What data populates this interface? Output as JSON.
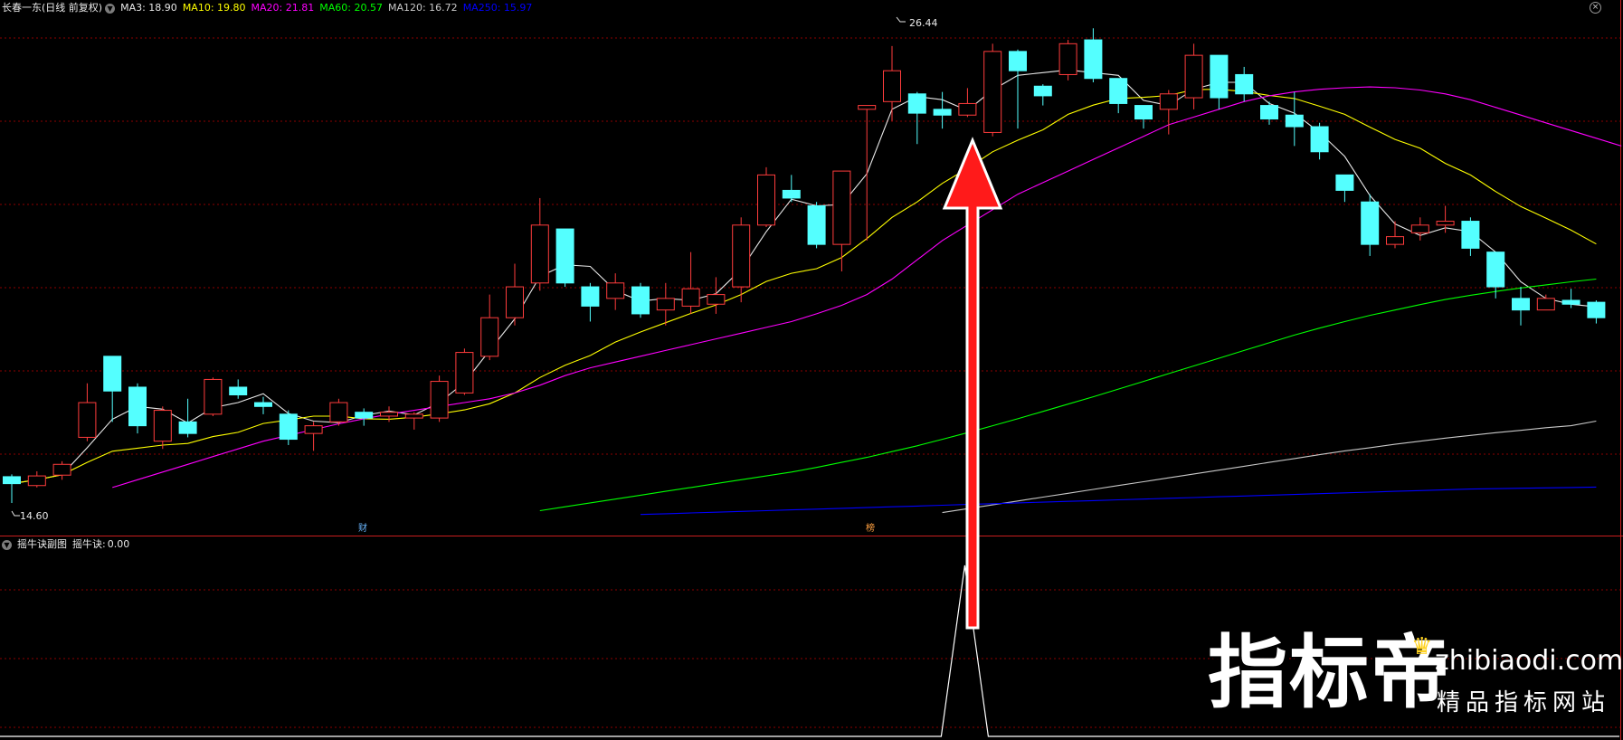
{
  "header": {
    "title": "长春一东(日线 前复权)",
    "ma_items": [
      {
        "label": "MA3:",
        "value": "18.90",
        "color": "#e8e8e8"
      },
      {
        "label": "MA10:",
        "value": "19.80",
        "color": "#ffff00"
      },
      {
        "label": "MA20:",
        "value": "21.81",
        "color": "#ff00ff"
      },
      {
        "label": "MA60:",
        "value": "20.57",
        "color": "#00ff00"
      },
      {
        "label": "MA120:",
        "value": "16.72",
        "color": "#c8c8c8"
      },
      {
        "label": "MA250:",
        "value": "15.97",
        "color": "#0000ff"
      }
    ]
  },
  "sub_header": {
    "title": "摇牛诀副图",
    "indicator_label": "摇牛诀:",
    "indicator_value": "0.00"
  },
  "annotations": {
    "high_label": "26.44",
    "low_label": "14.60",
    "badge1": "财",
    "badge2": "榜"
  },
  "watermark": {
    "big": "指标帝",
    "url": "zhibiaodi.com",
    "sub": "精品指标网站"
  },
  "colors": {
    "up": "#ff3c3c",
    "down": "#54ffff",
    "grid": "#8b0000",
    "separator": "#c81e1e"
  },
  "chart_data": {
    "type": "candlestick",
    "y_range": [
      14.2,
      27.0
    ],
    "candles": [
      [
        15.28,
        15.1,
        15.34,
        14.6
      ],
      [
        15.05,
        15.3,
        15.42,
        15.0
      ],
      [
        15.32,
        15.6,
        15.68,
        15.2
      ],
      [
        16.3,
        17.2,
        17.7,
        16.2
      ],
      [
        18.4,
        17.5,
        18.4,
        16.7
      ],
      [
        17.6,
        16.6,
        17.7,
        16.4
      ],
      [
        16.2,
        17.0,
        17.1,
        16.0
      ],
      [
        16.7,
        16.4,
        17.3,
        16.3
      ],
      [
        16.9,
        17.8,
        17.85,
        16.85
      ],
      [
        17.6,
        17.4,
        17.8,
        17.3
      ],
      [
        17.2,
        17.1,
        17.35,
        16.9
      ],
      [
        16.9,
        16.25,
        17.0,
        16.1
      ],
      [
        16.4,
        16.6,
        16.7,
        15.95
      ],
      [
        16.7,
        17.2,
        17.3,
        16.6
      ],
      [
        16.95,
        16.8,
        17.05,
        16.6
      ],
      [
        16.85,
        16.95,
        17.1,
        16.7
      ],
      [
        16.8,
        16.9,
        16.95,
        16.5
      ],
      [
        16.8,
        17.75,
        17.9,
        16.7
      ],
      [
        17.45,
        18.5,
        18.6,
        17.4
      ],
      [
        18.4,
        19.4,
        20.0,
        18.3
      ],
      [
        19.4,
        20.2,
        20.8,
        19.2
      ],
      [
        20.3,
        21.8,
        22.5,
        20.1
      ],
      [
        21.7,
        20.3,
        21.7,
        20.2
      ],
      [
        20.2,
        19.7,
        20.3,
        19.3
      ],
      [
        19.9,
        20.3,
        20.55,
        19.6
      ],
      [
        20.2,
        19.5,
        20.3,
        19.4
      ],
      [
        19.6,
        19.9,
        20.3,
        19.2
      ],
      [
        19.7,
        20.15,
        21.1,
        19.5
      ],
      [
        19.75,
        20.0,
        20.45,
        19.5
      ],
      [
        20.2,
        21.8,
        22.0,
        19.8
      ],
      [
        21.8,
        23.1,
        23.3,
        21.75
      ],
      [
        22.7,
        22.5,
        23.1,
        22.4
      ],
      [
        22.3,
        21.3,
        22.4,
        21.2
      ],
      [
        21.3,
        23.2,
        23.2,
        20.6
      ],
      [
        24.8,
        24.9,
        24.9,
        21.4
      ],
      [
        25.0,
        25.8,
        26.44,
        24.5
      ],
      [
        25.2,
        24.7,
        25.25,
        23.9
      ],
      [
        24.8,
        24.65,
        25.25,
        24.3
      ],
      [
        24.65,
        24.95,
        25.35,
        24.6
      ],
      [
        24.2,
        26.3,
        26.5,
        24.1
      ],
      [
        26.3,
        25.8,
        26.35,
        24.3
      ],
      [
        25.4,
        25.15,
        25.45,
        24.9
      ],
      [
        25.7,
        26.5,
        26.6,
        25.55
      ],
      [
        26.6,
        25.6,
        26.9,
        25.5
      ],
      [
        25.6,
        24.95,
        25.6,
        24.7
      ],
      [
        24.9,
        24.55,
        24.9,
        24.3
      ],
      [
        24.8,
        25.2,
        25.3,
        24.15
      ],
      [
        25.1,
        26.2,
        26.5,
        24.8
      ],
      [
        26.2,
        25.1,
        26.2,
        24.8
      ],
      [
        25.7,
        25.2,
        25.9,
        25.0
      ],
      [
        24.9,
        24.55,
        25.0,
        24.4
      ],
      [
        24.65,
        24.35,
        25.25,
        23.85
      ],
      [
        24.35,
        23.7,
        24.45,
        23.5
      ],
      [
        23.1,
        22.7,
        23.1,
        22.4
      ],
      [
        22.4,
        21.3,
        22.6,
        21.0
      ],
      [
        21.3,
        21.5,
        21.9,
        21.2
      ],
      [
        21.6,
        21.8,
        22.0,
        21.4
      ],
      [
        21.8,
        21.9,
        22.3,
        21.6
      ],
      [
        21.9,
        21.2,
        22.0,
        21.0
      ],
      [
        21.1,
        20.2,
        21.1,
        19.9
      ],
      [
        19.9,
        19.6,
        20.2,
        19.2
      ],
      [
        19.6,
        19.9,
        20.0,
        19.6
      ],
      [
        19.85,
        19.75,
        20.15,
        19.65
      ],
      [
        19.8,
        19.4,
        19.85,
        19.25
      ]
    ],
    "ma": [
      {
        "name": "MA3",
        "color": "#e8e8e8",
        "start": 0,
        "values": [
          15.1,
          15.2,
          15.33,
          16.03,
          16.77,
          17.1,
          17.03,
          16.67,
          17.07,
          17.2,
          17.43,
          16.92,
          16.72,
          16.68,
          16.87,
          16.98,
          16.88,
          17.2,
          17.72,
          18.55,
          19.37,
          20.47,
          20.77,
          20.73,
          20.1,
          19.83,
          19.9,
          19.85,
          20.02,
          20.65,
          21.63,
          22.47,
          22.3,
          22.33,
          23.13,
          24.8,
          25.13,
          25.05,
          24.77,
          25.3,
          25.68,
          25.75,
          25.82,
          25.75,
          25.68,
          25.03,
          24.9,
          25.32,
          25.5,
          25.5,
          24.95,
          24.7,
          24.2,
          23.58,
          22.57,
          21.83,
          21.53,
          21.73,
          21.63,
          21.1,
          20.33,
          19.9,
          19.75,
          19.68
        ]
      },
      {
        "name": "MA10",
        "color": "#ffff00",
        "start": 0,
        "values": [
          15.1,
          15.2,
          15.33,
          15.65,
          15.94,
          16.02,
          16.1,
          16.14,
          16.32,
          16.43,
          16.66,
          16.75,
          16.85,
          16.85,
          16.78,
          16.77,
          16.82,
          16.91,
          17.01,
          17.17,
          17.45,
          17.85,
          18.17,
          18.42,
          18.77,
          19.03,
          19.27,
          19.51,
          19.73,
          20.0,
          20.34,
          20.55,
          20.67,
          20.96,
          21.45,
          22.0,
          22.4,
          22.88,
          23.27,
          23.7,
          24.0,
          24.27,
          24.67,
          24.91,
          25.08,
          25.11,
          25.16,
          25.31,
          25.32,
          25.26,
          25.16,
          25.08,
          24.88,
          24.67,
          24.34,
          24.02,
          23.79,
          23.4,
          23.1,
          22.67,
          22.28,
          21.98,
          21.67,
          21.31
        ]
      },
      {
        "name": "MA20",
        "color": "#ff00ff",
        "start": 4,
        "values": [
          15.0,
          15.2,
          15.4,
          15.6,
          15.8,
          16.0,
          16.2,
          16.35,
          16.5,
          16.65,
          16.78,
          16.9,
          17.0,
          17.1,
          17.2,
          17.3,
          17.45,
          17.65,
          17.9,
          18.1,
          18.25,
          18.4,
          18.55,
          18.7,
          18.85,
          19.0,
          19.15,
          19.3,
          19.5,
          19.72,
          20.0,
          20.4,
          20.9,
          21.4,
          21.8,
          22.2,
          22.6,
          22.9,
          23.2,
          23.5,
          23.8,
          24.1,
          24.4,
          24.6,
          24.8,
          25.0,
          25.15,
          25.25,
          25.32,
          25.36,
          25.38,
          25.36,
          25.3,
          25.2,
          25.05,
          24.85,
          24.65,
          24.45,
          24.25,
          24.05,
          23.85
        ]
      },
      {
        "name": "MA60",
        "color": "#00ff00",
        "start": 21,
        "values": [
          14.4,
          14.5,
          14.6,
          14.7,
          14.8,
          14.9,
          15.0,
          15.1,
          15.2,
          15.3,
          15.4,
          15.52,
          15.65,
          15.78,
          15.93,
          16.08,
          16.25,
          16.42,
          16.6,
          16.78,
          16.97,
          17.16,
          17.35,
          17.55,
          17.75,
          17.95,
          18.15,
          18.35,
          18.55,
          18.75,
          18.95,
          19.13,
          19.3,
          19.46,
          19.6,
          19.74,
          19.87,
          19.98,
          20.08,
          20.17,
          20.25,
          20.33,
          20.4
        ]
      },
      {
        "name": "MA120",
        "color": "#c8c8c8",
        "start": 37,
        "values": [
          14.35,
          14.45,
          14.55,
          14.65,
          14.75,
          14.85,
          14.95,
          15.05,
          15.15,
          15.25,
          15.35,
          15.45,
          15.55,
          15.65,
          15.75,
          15.85,
          15.95,
          16.03,
          16.12,
          16.2,
          16.28,
          16.35,
          16.42,
          16.48,
          16.55,
          16.6,
          16.72
        ]
      },
      {
        "name": "MA250",
        "color": "#0000ff",
        "start": 25,
        "values": [
          14.3,
          14.32,
          14.34,
          14.36,
          14.38,
          14.4,
          14.42,
          14.44,
          14.46,
          14.48,
          14.5,
          14.52,
          14.54,
          14.56,
          14.58,
          14.6,
          14.62,
          14.64,
          14.66,
          14.68,
          14.7,
          14.72,
          14.74,
          14.76,
          14.78,
          14.8,
          14.82,
          14.84,
          14.86,
          14.88,
          14.9,
          14.92,
          14.94,
          14.96,
          14.97,
          14.98,
          14.99,
          15.0,
          15.01
        ]
      }
    ],
    "sub_series": {
      "name": "摇牛诀",
      "spike_index": 38,
      "spike_value": 1.0,
      "base_value": 0.0
    }
  }
}
